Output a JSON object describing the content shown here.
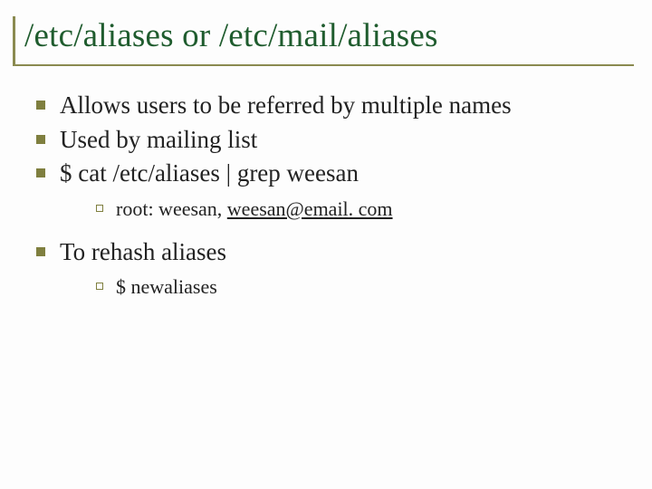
{
  "title": "/etc/aliases or /etc/mail/aliases",
  "points": {
    "p1": "Allows users to be referred by multiple names",
    "p2": "Used by mailing list",
    "p3": "$ cat /etc/aliases | grep weesan",
    "p3_sub_prefix": "root: weesan, ",
    "p3_sub_link": "weesan@email. com",
    "p4": "To rehash aliases",
    "p4_sub": "$ newaliases"
  }
}
